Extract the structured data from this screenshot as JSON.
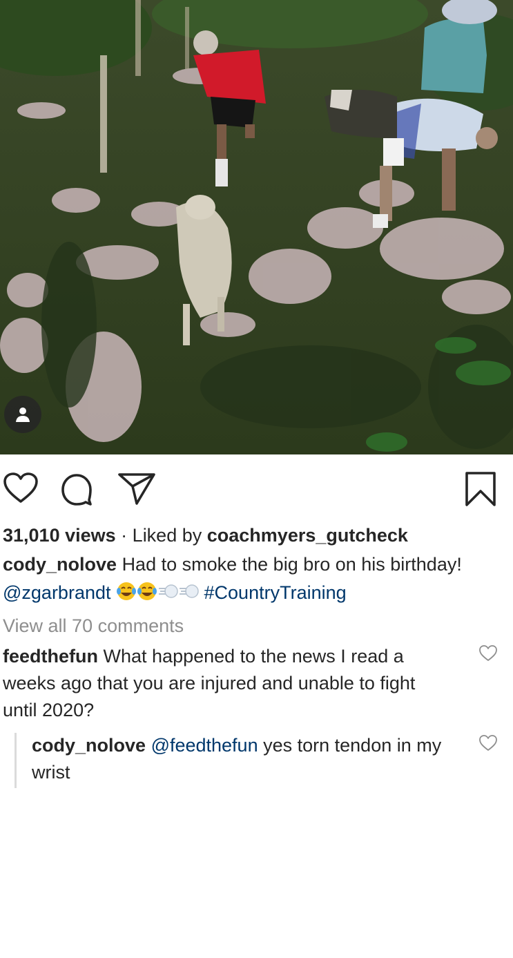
{
  "post": {
    "views": "31,010 views",
    "liked_by_prefix": "Liked by",
    "liked_by_user": "coachmyers_gutcheck",
    "caption_user": "cody_nolove",
    "caption_text_1": "Had to smoke the big bro on his birthday!",
    "caption_mention": "@zgarbrandt",
    "caption_emojis": [
      "face-with-tears-of-joy",
      "face-with-tears-of-joy",
      "dash-symbol",
      "dash-symbol"
    ],
    "caption_hashtag": "#CountryTraining",
    "view_all_comments": "View all 70 comments"
  },
  "icons": {
    "like": "heart-icon",
    "comment": "comment-bubble-icon",
    "share": "paper-plane-icon",
    "save": "bookmark-icon",
    "tag": "user-tag-icon"
  },
  "comments": [
    {
      "user": "feedthefun",
      "text": "What happened to the news I read a weeks ago that you are injured and unable to fight until 2020?"
    }
  ],
  "replies": [
    {
      "user": "cody_nolove",
      "mention": "@feedthefun",
      "text": "yes torn tendon in my wrist"
    }
  ],
  "colors": {
    "text": "#262626",
    "link": "#00376b",
    "muted": "#8e8e8e",
    "divider": "#dbdbdb"
  }
}
